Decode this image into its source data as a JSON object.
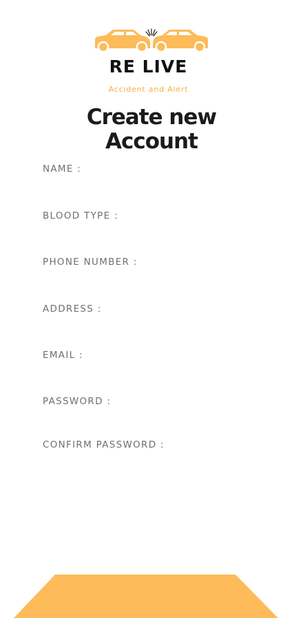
{
  "app": {
    "brand": "RE LIVE",
    "tagline": "Accident and Alert",
    "accent_color": "#fdbb5a",
    "logo_icon": "car-crash-icon"
  },
  "page": {
    "title_line1": "Create new",
    "title_line2": "Account"
  },
  "form": {
    "fields": [
      {
        "label": "NAME :",
        "value": ""
      },
      {
        "label": "BLOOD TYPE :",
        "value": ""
      },
      {
        "label": "PHONE NUMBER :",
        "value": ""
      },
      {
        "label": "ADDRESS :",
        "value": ""
      },
      {
        "label": "EMAIL :",
        "value": ""
      },
      {
        "label": "PASSWORD :",
        "value": ""
      },
      {
        "label": "CONFIRM PASSWORD :",
        "value": ""
      }
    ]
  }
}
